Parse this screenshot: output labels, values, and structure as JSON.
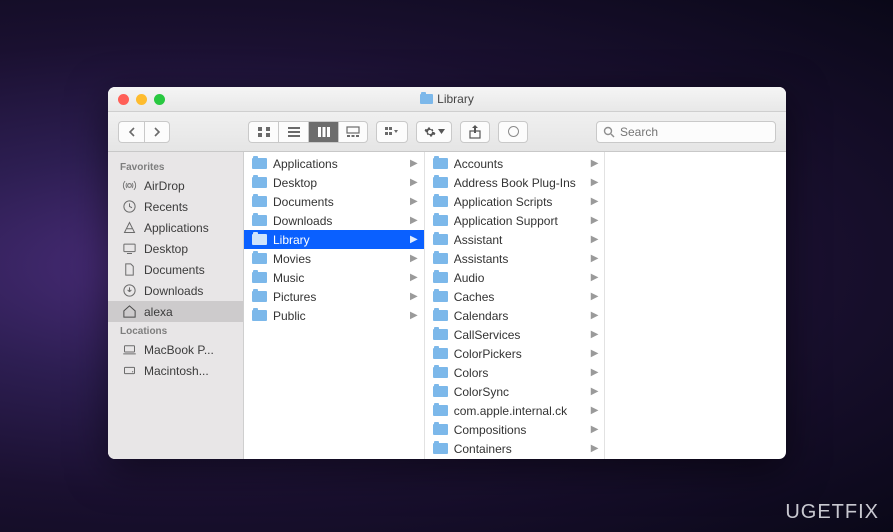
{
  "window": {
    "title": "Library"
  },
  "toolbar": {
    "search_placeholder": "Search"
  },
  "sidebar": {
    "sections": [
      {
        "header": "Favorites",
        "items": [
          {
            "icon": "airdrop",
            "label": "AirDrop"
          },
          {
            "icon": "recents",
            "label": "Recents"
          },
          {
            "icon": "applications",
            "label": "Applications"
          },
          {
            "icon": "desktop",
            "label": "Desktop"
          },
          {
            "icon": "documents",
            "label": "Documents"
          },
          {
            "icon": "downloads",
            "label": "Downloads"
          },
          {
            "icon": "home",
            "label": "alexa",
            "selected": true
          }
        ]
      },
      {
        "header": "Locations",
        "items": [
          {
            "icon": "laptop",
            "label": "MacBook P..."
          },
          {
            "icon": "disk",
            "label": "Macintosh..."
          }
        ]
      }
    ]
  },
  "columns": [
    [
      {
        "label": "Applications",
        "hasChildren": true
      },
      {
        "label": "Desktop",
        "hasChildren": true
      },
      {
        "label": "Documents",
        "hasChildren": true
      },
      {
        "label": "Downloads",
        "hasChildren": true
      },
      {
        "label": "Library",
        "hasChildren": true,
        "selected": true
      },
      {
        "label": "Movies",
        "hasChildren": true
      },
      {
        "label": "Music",
        "hasChildren": true
      },
      {
        "label": "Pictures",
        "hasChildren": true
      },
      {
        "label": "Public",
        "hasChildren": true
      }
    ],
    [
      {
        "label": "Accounts",
        "hasChildren": true
      },
      {
        "label": "Address Book Plug-Ins",
        "hasChildren": true
      },
      {
        "label": "Application Scripts",
        "hasChildren": true
      },
      {
        "label": "Application Support",
        "hasChildren": true
      },
      {
        "label": "Assistant",
        "hasChildren": true
      },
      {
        "label": "Assistants",
        "hasChildren": true
      },
      {
        "label": "Audio",
        "hasChildren": true
      },
      {
        "label": "Caches",
        "hasChildren": true
      },
      {
        "label": "Calendars",
        "hasChildren": true
      },
      {
        "label": "CallServices",
        "hasChildren": true
      },
      {
        "label": "ColorPickers",
        "hasChildren": true
      },
      {
        "label": "Colors",
        "hasChildren": true
      },
      {
        "label": "ColorSync",
        "hasChildren": true
      },
      {
        "label": "com.apple.internal.ck",
        "hasChildren": true
      },
      {
        "label": "Compositions",
        "hasChildren": true
      },
      {
        "label": "Containers",
        "hasChildren": true
      }
    ]
  ],
  "watermark": "UGETFIX"
}
